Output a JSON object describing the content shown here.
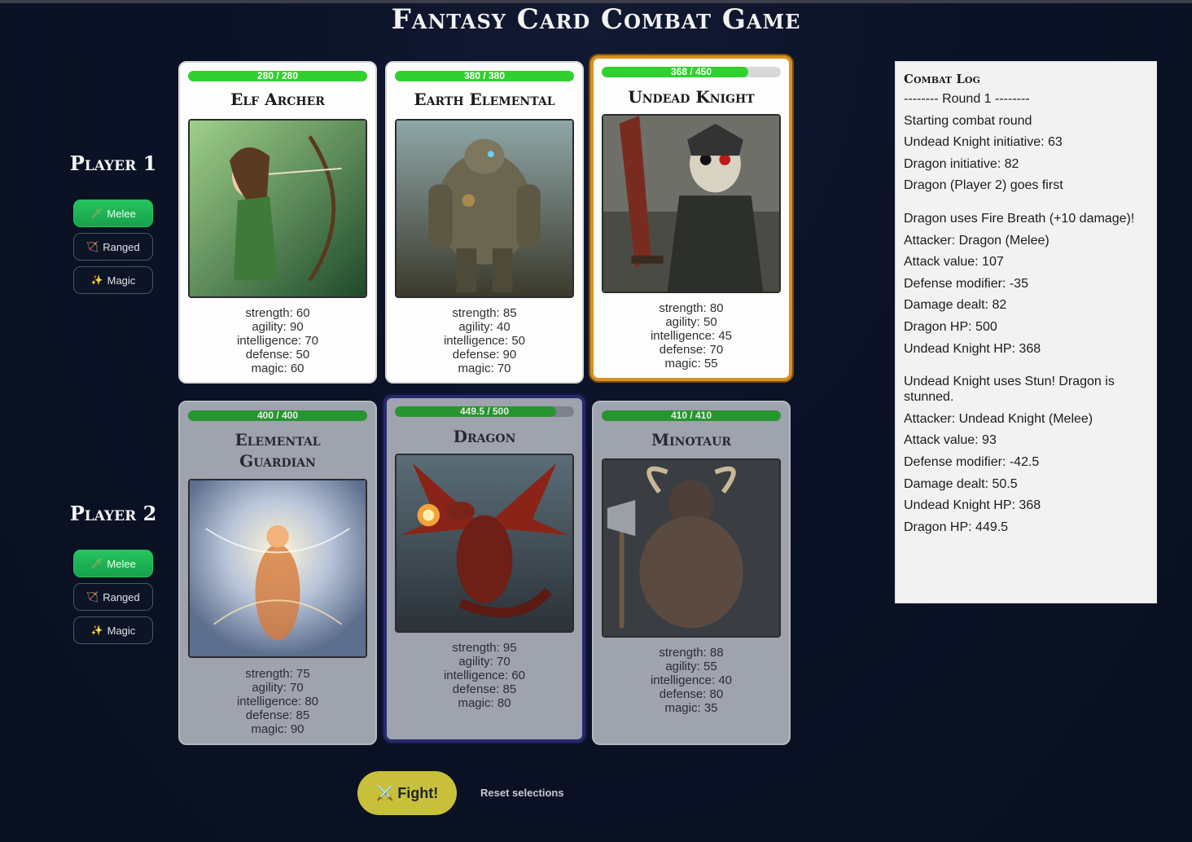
{
  "app": {
    "title": "Fantasy Card Combat Game"
  },
  "players": [
    {
      "label": "Player 1",
      "attacks": [
        {
          "label": "Melee",
          "icon": "sword-icon",
          "active": true
        },
        {
          "label": "Ranged",
          "icon": "bow-icon",
          "active": false
        },
        {
          "label": "Magic",
          "icon": "wand-icon",
          "active": false
        }
      ],
      "cards": [
        {
          "name": "Elf Archer",
          "hp_text": "280 / 280",
          "hp_fraction": 1.0,
          "stats": {
            "strength": "strength: 60",
            "agility": "agility: 90",
            "intelligence": "intelligence: 70",
            "defense": "defense: 50",
            "magic": "magic: 60"
          }
        },
        {
          "name": "Earth Elemental",
          "hp_text": "380 / 380",
          "hp_fraction": 1.0,
          "stats": {
            "strength": "strength: 85",
            "agility": "agility: 40",
            "intelligence": "intelligence: 50",
            "defense": "defense: 90",
            "magic": "magic: 70"
          }
        },
        {
          "name": "Undead Knight",
          "hp_text": "368 / 450",
          "hp_fraction": 0.818,
          "selected": true,
          "stats": {
            "strength": "strength: 80",
            "agility": "agility: 50",
            "intelligence": "intelligence: 45",
            "defense": "defense: 70",
            "magic": "magic: 55"
          }
        }
      ]
    },
    {
      "label": "Player 2",
      "attacks": [
        {
          "label": "Melee",
          "icon": "sword-icon",
          "active": true
        },
        {
          "label": "Ranged",
          "icon": "bow-icon",
          "active": false
        },
        {
          "label": "Magic",
          "icon": "wand-icon",
          "active": false
        }
      ],
      "cards": [
        {
          "name": "Elemental Guardian",
          "hp_text": "400 / 400",
          "hp_fraction": 1.0,
          "stats": {
            "strength": "strength: 75",
            "agility": "agility: 70",
            "intelligence": "intelligence: 80",
            "defense": "defense: 85",
            "magic": "magic: 90"
          }
        },
        {
          "name": "Dragon",
          "hp_text": "449.5 / 500",
          "hp_fraction": 0.899,
          "selected": true,
          "stats": {
            "strength": "strength: 95",
            "agility": "agility: 70",
            "intelligence": "intelligence: 60",
            "defense": "defense: 85",
            "magic": "magic: 80"
          }
        },
        {
          "name": "Minotaur",
          "hp_text": "410 / 410",
          "hp_fraction": 1.0,
          "stats": {
            "strength": "strength: 88",
            "agility": "agility: 55",
            "intelligence": "intelligence: 40",
            "defense": "defense: 80",
            "magic": "magic: 35"
          }
        }
      ]
    }
  ],
  "combat_log": {
    "title": "Combat Log",
    "lines": [
      "-------- Round 1 --------",
      "Starting combat round",
      "Undead Knight initiative: 63",
      "Dragon initiative: 82",
      "Dragon (Player 2) goes first",
      "",
      "Dragon uses Fire Breath (+10 damage)!",
      "Attacker: Dragon (Melee)",
      "Attack value: 107",
      "Defense modifier: -35",
      "Damage dealt: 82",
      "Dragon HP: 500",
      "Undead Knight HP: 368",
      "",
      "Undead Knight uses Stun! Dragon is stunned.",
      "Attacker: Undead Knight (Melee)",
      "Attack value: 93",
      "Defense modifier: -42.5",
      "Damage dealt: 50.5",
      "Undead Knight HP: 368",
      "Dragon HP: 449.5"
    ]
  },
  "actions": {
    "fight_label": "Fight!",
    "fight_icon": "crossed-swords-icon",
    "reset_label": "Reset selections"
  },
  "colors": {
    "background": "#0b1227",
    "hp_green": "#2fd12f",
    "active_button": "#25c55f",
    "selected_p1": "#d8901f",
    "selected_p2": "#262a6a",
    "fight_button": "#c8c03a"
  }
}
